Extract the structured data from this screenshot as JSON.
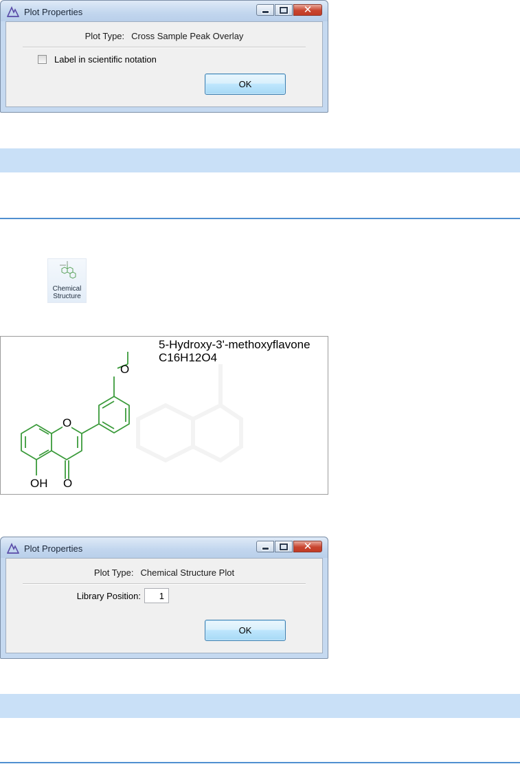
{
  "dialog1": {
    "title": "Plot Properties",
    "plot_type_label": "Plot Type:",
    "plot_type_value": "Cross Sample Peak Overlay",
    "checkbox_label": "Label in scientific notation",
    "checkbox_checked": false,
    "ok_label": "OK"
  },
  "ribbon": {
    "label_line1": "Chemical",
    "label_line2": "Structure"
  },
  "structure_plot": {
    "compound_name": "5-Hydroxy-3'-methoxyflavone",
    "formula": "C16H12O4",
    "atom_labels": {
      "oh": "OH",
      "ketone_o": "O",
      "ring_o": "O",
      "methoxy_o": "O"
    },
    "bond_color": "#3a9a3a"
  },
  "dialog2": {
    "title": "Plot Properties",
    "plot_type_label": "Plot Type:",
    "plot_type_value": "Chemical Structure Plot",
    "library_position_label": "Library Position:",
    "library_position_value": "1",
    "ok_label": "OK"
  },
  "colors": {
    "note_bar": "#c9e0f7",
    "rule": "#4f8fd0"
  }
}
